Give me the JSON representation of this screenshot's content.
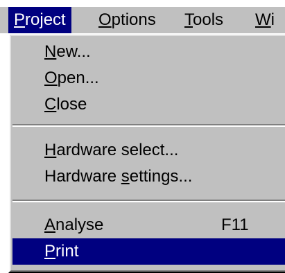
{
  "menubar": {
    "items": [
      {
        "label": "Project",
        "mnemonic": "P",
        "rest": "roject",
        "active": true
      },
      {
        "label": "Options",
        "mnemonic": "O",
        "rest": "ptions"
      },
      {
        "label": "Tools",
        "mnemonic": "T",
        "rest": "ools"
      },
      {
        "label": "Wi",
        "mnemonic": "W",
        "rest": "i"
      }
    ]
  },
  "dropdown": {
    "items": [
      {
        "pre": "",
        "mnemonic": "N",
        "post": "ew...",
        "shortcut": ""
      },
      {
        "pre": "",
        "mnemonic": "O",
        "post": "pen...",
        "shortcut": ""
      },
      {
        "pre": "",
        "mnemonic": "C",
        "post": "lose",
        "shortcut": ""
      },
      {
        "pre": "",
        "mnemonic": "H",
        "post": "ardware select...",
        "shortcut": ""
      },
      {
        "pre": "Hardware ",
        "mnemonic": "s",
        "post": "ettings...",
        "shortcut": ""
      },
      {
        "pre": "",
        "mnemonic": "A",
        "post": "nalyse",
        "shortcut": "F11"
      },
      {
        "pre": "",
        "mnemonic": "P",
        "post": "rint",
        "shortcut": "",
        "highlighted": true
      }
    ]
  },
  "colors": {
    "face": "#c0c0c0",
    "highlight": "#000080",
    "highlight_text": "#ffffff"
  }
}
